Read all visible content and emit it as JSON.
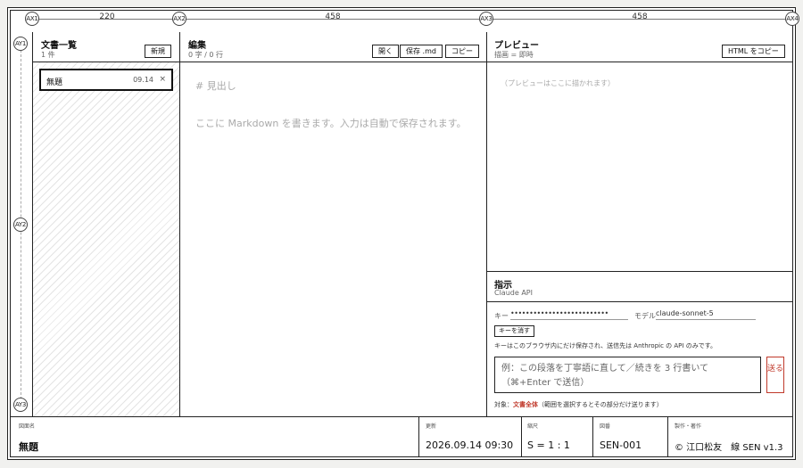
{
  "axes": {
    "x": [
      {
        "label": "AX1"
      },
      {
        "label": "AX2"
      },
      {
        "label": "AX3"
      },
      {
        "label": "AX4"
      }
    ],
    "y": [
      {
        "label": "AY1"
      },
      {
        "label": "AY2"
      },
      {
        "label": "AY3"
      }
    ],
    "dims": [
      "220",
      "458",
      "458"
    ]
  },
  "doclist": {
    "title": "文書一覧",
    "count": "1 件",
    "new_label": "新規",
    "items": [
      {
        "name": "無題",
        "date": "09.14",
        "close": "×"
      }
    ]
  },
  "editor": {
    "title": "編集",
    "stats": "0 字 / 0 行",
    "open_label": "開く",
    "save_label": "保存 .md",
    "copy_label": "コピー",
    "placeholder_heading": "# 見出し",
    "placeholder_body": "ここに Markdown を書きます。入力は自動で保存されます。"
  },
  "preview": {
    "title": "プレビュー",
    "sub": "描画 = 即時",
    "copy_html_label": "HTML をコピー",
    "placeholder": "（プレビューはここに描かれます）"
  },
  "instruction": {
    "title": "指示",
    "sub": "Claude API",
    "key_label": "キー",
    "key_value": "••••••••••••••••••••••••••",
    "model_label": "モデル",
    "model_value": "claude-sonnet-5",
    "clear_key_label": "キーを消す",
    "key_note": "キーはこのブラウザ内にだけ保存され、送信先は Anthropic の API のみです。",
    "prompt_placeholder": "例：この段落を丁寧語に直して／続きを 3 行書いて（⌘+Enter で送信）",
    "send_label": "送る",
    "target_prefix": "対象：",
    "target_value": "文書全体",
    "target_suffix": "（範囲を選択するとその部分だけ送ります）"
  },
  "titleblock": {
    "drawing_name_label": "図面名",
    "drawing_name": "無題",
    "updated_label": "更新",
    "updated": "2026.09.14 09:30",
    "scale_label": "縮尺",
    "scale": "S = 1 : 1",
    "number_label": "図番",
    "number": "SEN-001",
    "author_label": "製作・著作",
    "author": "© 江口松友　線 SEN v1.3"
  }
}
